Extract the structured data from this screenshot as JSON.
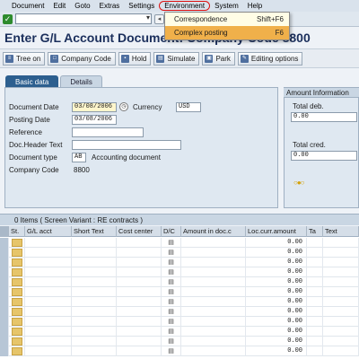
{
  "menu": {
    "items": [
      "Document",
      "Edit",
      "Goto",
      "Extras",
      "Settings",
      "Environment",
      "System",
      "Help"
    ]
  },
  "dropdown": {
    "items": [
      {
        "label": "Correspondence",
        "shortcut": "Shift+F6"
      },
      {
        "label": "Complex posting",
        "shortcut": "F6"
      }
    ]
  },
  "title": "Enter G/L Account Document: Company Code 8800",
  "app_toolbar": {
    "buttons": [
      "Tree on",
      "Company Code",
      "Hold",
      "Simulate",
      "Park",
      "Editing options"
    ]
  },
  "tabs": [
    "Basic data",
    "Details"
  ],
  "form": {
    "document_date_label": "Document Date",
    "document_date_value": "03/08/2006",
    "currency_label": "Currency",
    "currency_value": "USD",
    "posting_date_label": "Posting Date",
    "posting_date_value": "03/08/2006",
    "reference_label": "Reference",
    "doc_header_label": "Doc.Header Text",
    "document_type_label": "Document type",
    "document_type_value": "AB",
    "document_type_desc": "Accounting document",
    "company_code_label": "Company Code",
    "company_code_value": "8800"
  },
  "amount_info": {
    "title": "Amount Information",
    "total_deb_label": "Total deb.",
    "total_deb_value": "0.00",
    "total_cred_label": "Total cred.",
    "total_cred_value": "0.00"
  },
  "table": {
    "caption": "0 Items ( Screen Variant : RE contracts )",
    "columns": [
      "St.",
      "G/L acct",
      "Short Text",
      "Cost center",
      "D/C",
      "Amount in doc.c",
      "Loc.curr.amount",
      "Ta",
      "Text"
    ],
    "row_amount": "0.00",
    "row_count": 12
  },
  "colors": {
    "title": "#1b2f5c",
    "active_tab": "#2d5f8f",
    "menu_highlight": "#f0b04a",
    "required_field": "#fff6cc"
  }
}
